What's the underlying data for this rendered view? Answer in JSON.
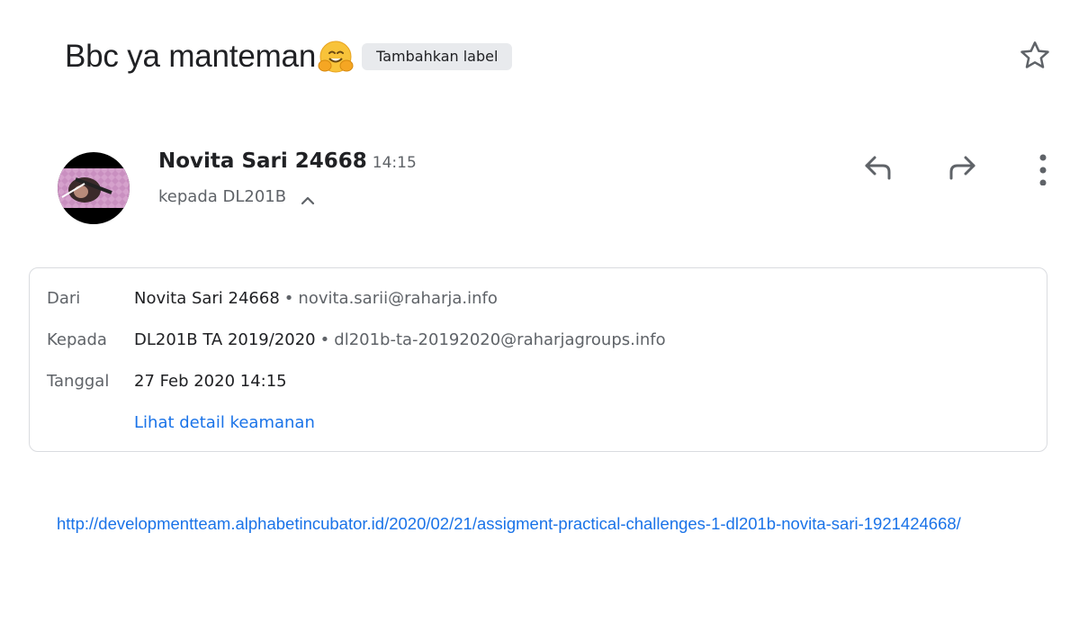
{
  "subject": {
    "text": "Bbc ya manteman",
    "emoji": "hugging-face-emoji",
    "label_chip": "Tambahkan label"
  },
  "header": {
    "sender_name": "Novita Sari 24668",
    "time": "14:15",
    "recipient_summary": "kepada DL201B",
    "icons": [
      "star-icon",
      "reply-icon",
      "forward-icon",
      "more-vert-icon",
      "chevron-up-icon"
    ]
  },
  "details": {
    "from_label": "Dari",
    "from_name": "Novita Sari 24668",
    "from_email": "novita.sarii@raharja.info",
    "to_label": "Kepada",
    "to_name": "DL201B TA 2019/2020",
    "to_email": "dl201b-ta-20192020@raharjagroups.info",
    "date_label": "Tanggal",
    "date_value": "27 Feb 2020 14:15",
    "security_link": "Lihat detail keamanan",
    "separator": "•"
  },
  "body": {
    "link": "http://developmentteam.alphabetincubator.id/2020/02/21/assigment-practical-challenges-1-dl201b-novita-sari-1921424668/"
  },
  "colors": {
    "link": "#1a73e8",
    "text_primary": "#202124",
    "text_secondary": "#5f6368",
    "chip_bg": "#e8eaed",
    "card_border": "#dadce0"
  }
}
